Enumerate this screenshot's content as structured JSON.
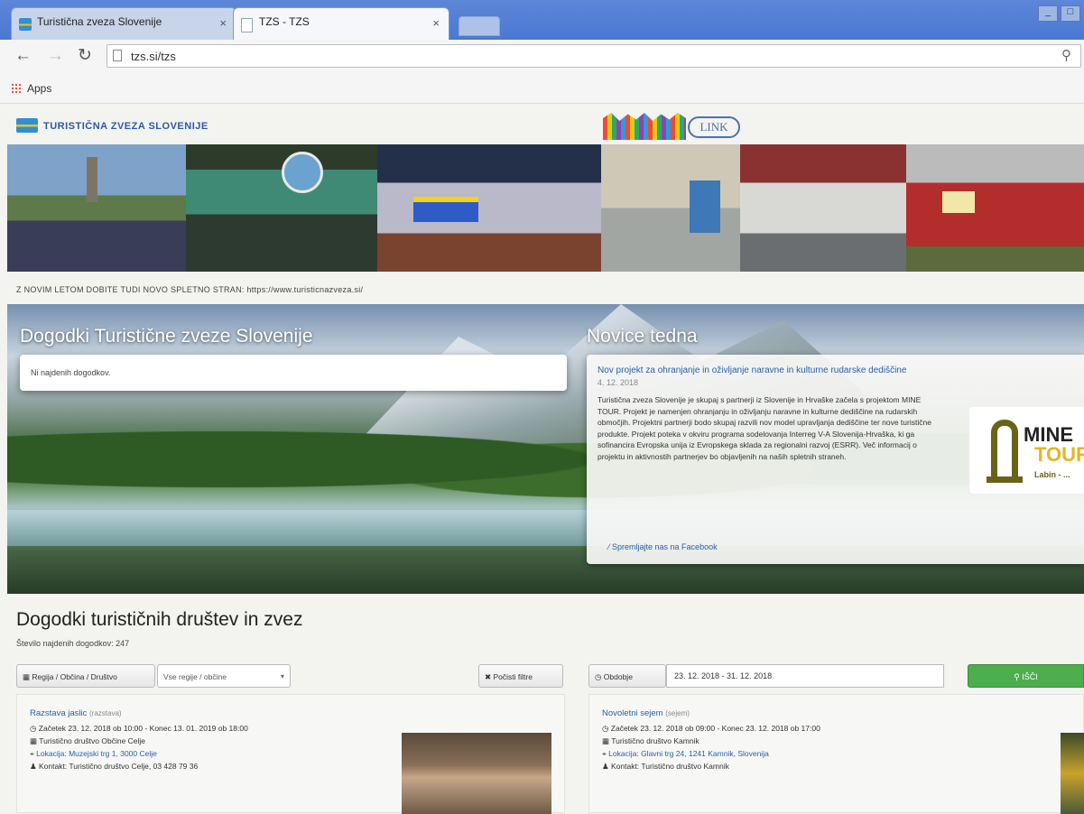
{
  "browser": {
    "tabs": [
      {
        "label": "Turistična zveza Slovenije",
        "close": "×"
      },
      {
        "label": "TZS - TZS",
        "close": "×"
      }
    ],
    "url": "tzs.si/tzs",
    "apps_label": "Apps",
    "window_buttons": [
      "_",
      "□"
    ]
  },
  "site": {
    "logo_text": "TURISTIČNA ZVEZA SLOVENIJE",
    "partner_logo_text": "LINK",
    "notice": "Z NOVIM LETOM DOBITE TUDI NOVO SPLETNO STRAN: https://www.turisticnazveza.si/"
  },
  "hero": {
    "events_heading": "Dogodki Turistične zveze Slovenije",
    "events_empty": "Ni najdenih dogodkov.",
    "news_heading": "Novice tedna",
    "news": {
      "title": "Nov projekt za ohranjanje in oživljanje naravne in kulturne rudarske dediščine",
      "date": "4. 12. 2018",
      "body": "Turistična zveza Slovenije je skupaj s partnerji iz Slovenije in Hrvaške začela s projektom MINE TOUR. Projekt je namenjen ohranjanju in oživljanju naravne in kulturne dediščine na rudarskih območjih. Projektni partnerji bodo skupaj razvili nov model upravljanja dediščine ter nove turistične produkte. Projekt poteka v okviru programa sodelovanja Interreg V-A Slovenija-Hrvaška, ki ga sofinancira Evropska unija iz Evropskega sklada za regionalni razvoj (ESRR). Več informacij o projektu in aktivnostih partnerjev bo objavljenih na naših spletnih straneh.",
      "logo_line1": "MINE",
      "logo_line2": "TOUR",
      "logo_line3": "Labin - ...",
      "facebook_link": "Spremljajte nas na Facebook"
    }
  },
  "societies": {
    "heading": "Dogodki turističnih društev in zvez",
    "subheading": "Število najdenih dogodkov: 247",
    "filters": {
      "region_label": "Regija / Občina / Društvo",
      "region_select": "Vse regije / občine",
      "clear_label": "Počisti filtre",
      "date_label": "Obdobje",
      "date_range": "23. 12. 2018 - 31. 12. 2018",
      "search_label": "IŠČI"
    },
    "events": [
      {
        "title": "Razstava jaslic",
        "type": "(razstava)",
        "when": "Začetek 23. 12. 2018 ob 10:00 - Konec 13. 01. 2019 ob 18:00",
        "org": "Turistično društvo Občine Celje",
        "where": "Lokacija: Muzejski trg 1, 3000 Celje",
        "contact": "Kontakt: Turistično društvo Celje, 03 428 79 36"
      },
      {
        "title": "Novoletni sejem",
        "type": "(sejem)",
        "when": "Začetek 23. 12. 2018 ob 09:00 - Konec 23. 12. 2018 ob 17:00",
        "org": "Turistično društvo Kamnik",
        "where": "Lokacija: Glavni trg 24, 1241 Kamnik, Slovenija",
        "contact": "Kontakt: Turistično društvo Kamnik"
      }
    ]
  }
}
